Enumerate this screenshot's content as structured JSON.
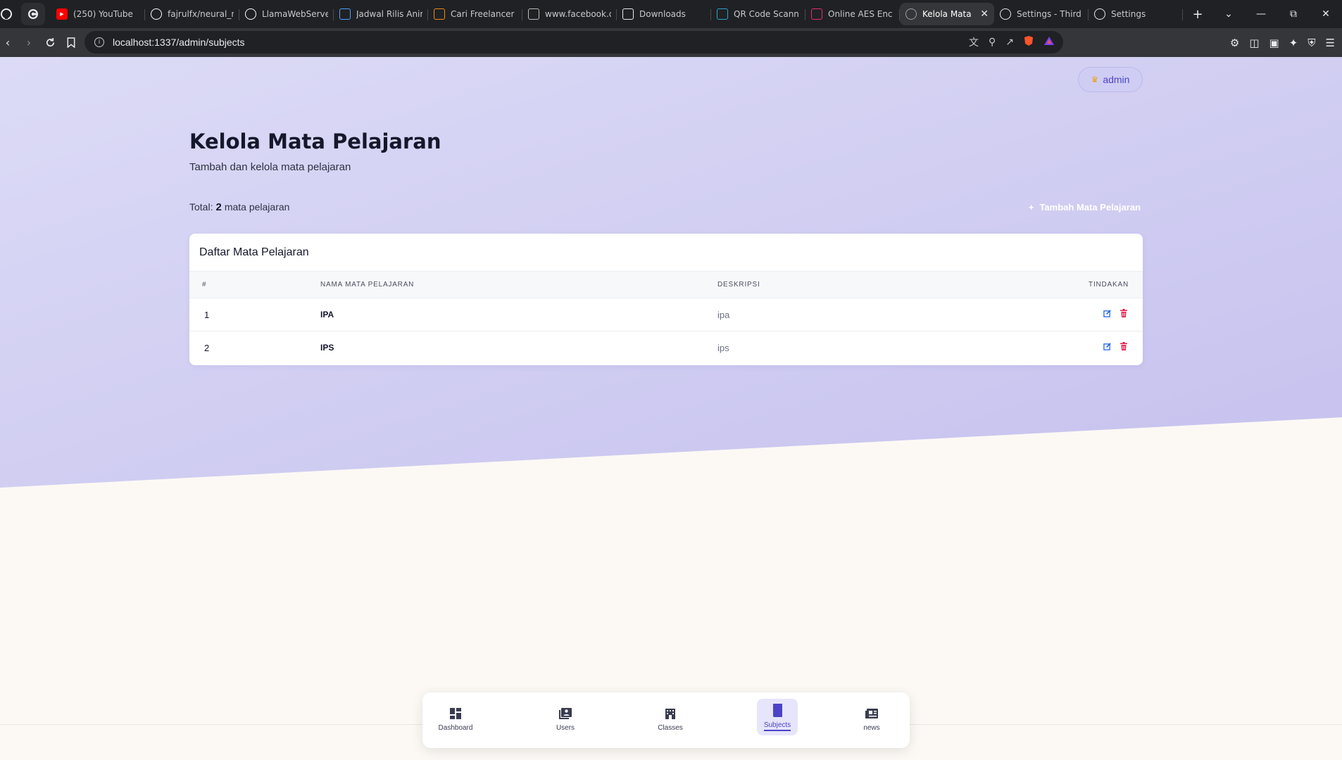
{
  "browser": {
    "tabs": [
      {
        "label": "(250) YouTube",
        "icon": "youtube-icon",
        "color": "#ff0000"
      },
      {
        "label": "fajrulfx/neural_n",
        "icon": "github-icon",
        "color": "#ffffff"
      },
      {
        "label": "LlamaWebServe",
        "icon": "github-icon",
        "color": "#ffffff"
      },
      {
        "label": "Jadwal Rilis Anir",
        "icon": "bookmark-icon",
        "color": "#4ea1ff"
      },
      {
        "label": "Cari Freelancer I",
        "icon": "freelancer-icon",
        "color": "#f08a1c"
      },
      {
        "label": "www.facebook.c",
        "icon": "facebook-icon",
        "color": "#bbbbbb"
      },
      {
        "label": "Downloads",
        "icon": "download-icon",
        "color": "#e8eaed"
      },
      {
        "label": "QR Code Scann",
        "icon": "qr-icon",
        "color": "#2aa6c8"
      },
      {
        "label": "Online AES Enc",
        "icon": "aes-icon",
        "color": "#e0306a"
      },
      {
        "label": "Kelola Mata",
        "icon": "loading-icon",
        "color": "#9aa0a6",
        "active": true
      },
      {
        "label": "Settings - Third",
        "icon": "gear-icon",
        "color": "#e8eaed"
      },
      {
        "label": "Settings",
        "icon": "gear-icon",
        "color": "#e8eaed"
      }
    ],
    "url": "localhost:1337/admin/subjects"
  },
  "header": {
    "user_badge": "admin"
  },
  "page": {
    "title": "Kelola Mata Pelajaran",
    "subtitle": "Tambah dan kelola mata pelajaran",
    "total_prefix": "Total:",
    "total_count": "2",
    "total_suffix": "mata pelajaran",
    "add_button_label": "Tambah Mata Pelajaran"
  },
  "table": {
    "title": "Daftar Mata Pelajaran",
    "columns": [
      "#",
      "NAMA MATA PELAJARAN",
      "DESKRIPSI",
      "TINDAKAN"
    ],
    "rows": [
      {
        "no": "1",
        "name": "IPA",
        "description": "ipa"
      },
      {
        "no": "2",
        "name": "IPS",
        "description": "ips"
      }
    ]
  },
  "bottom_nav": {
    "items": [
      {
        "label": "Dashboard",
        "icon": "dashboard-icon"
      },
      {
        "label": "Users",
        "icon": "users-icon"
      },
      {
        "label": "Classes",
        "icon": "classes-icon"
      },
      {
        "label": "Subjects",
        "icon": "subjects-icon",
        "active": true
      },
      {
        "label": "news",
        "icon": "news-icon"
      }
    ]
  },
  "colors": {
    "accent": "#4b44c8",
    "hero_start": "#d9d8f5",
    "hero_end": "#c8c3ef",
    "page_bg": "#fcf9f5",
    "edit": "#2563eb",
    "delete": "#e11d48"
  }
}
